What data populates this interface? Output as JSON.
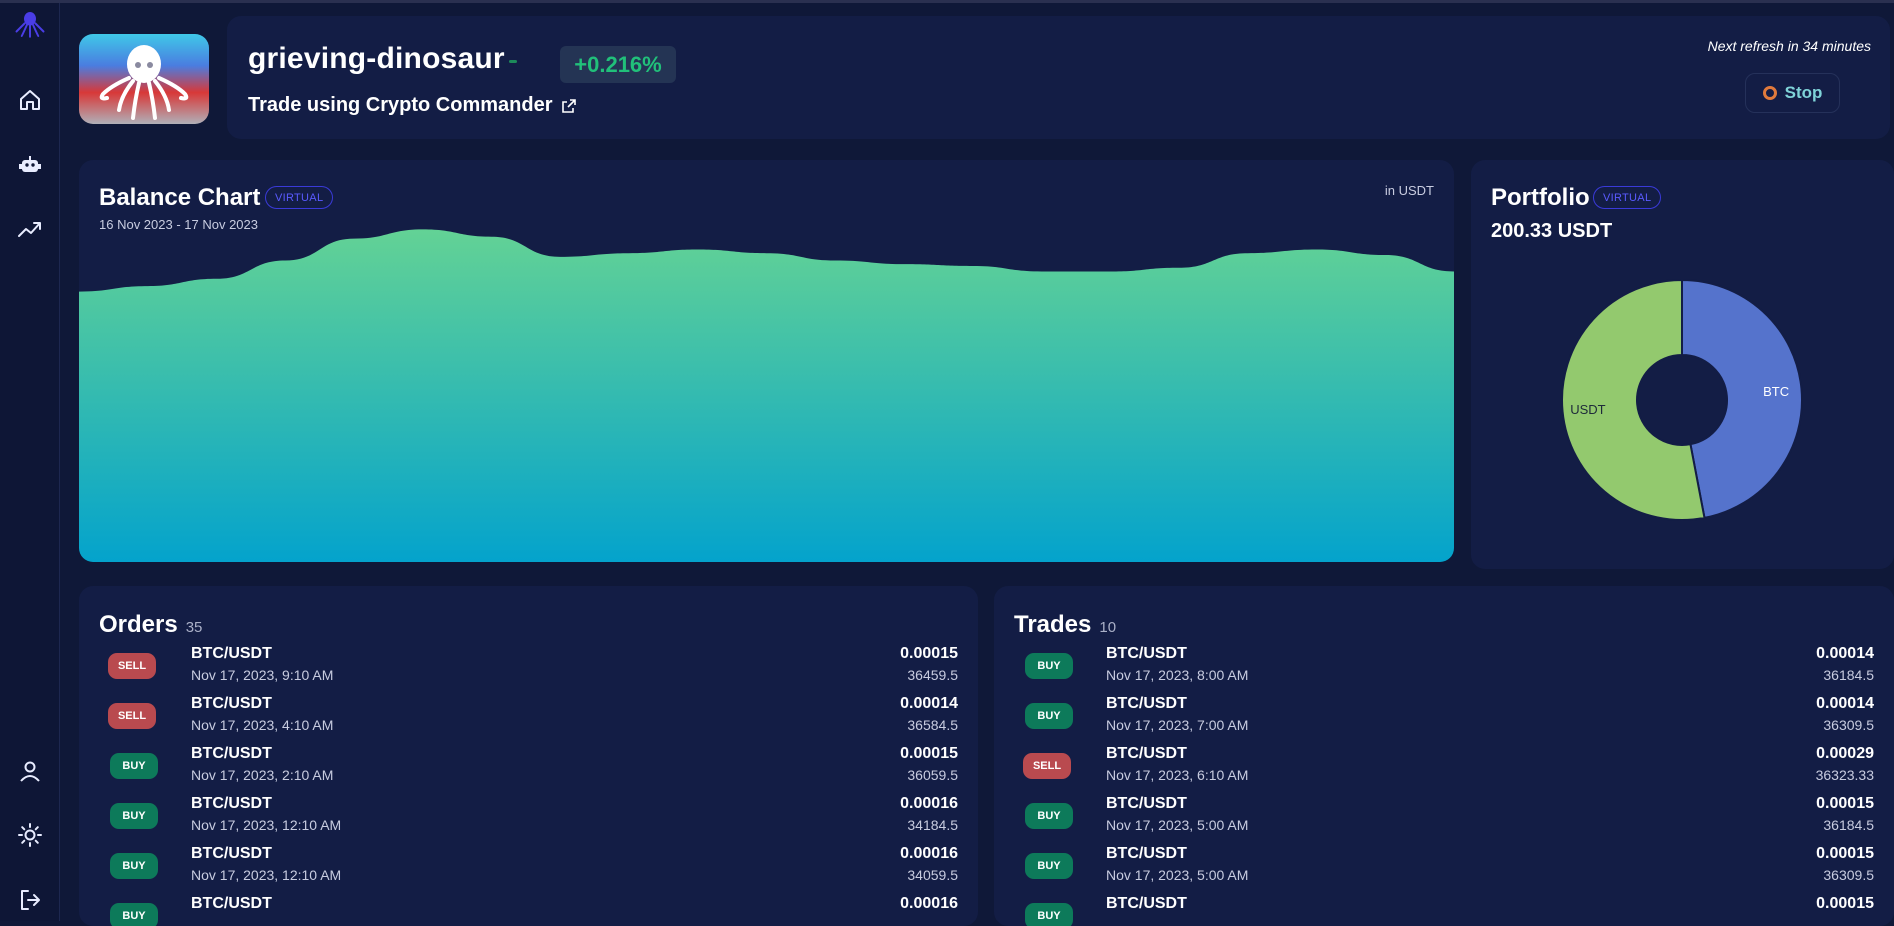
{
  "sidebar": {
    "items": [
      {
        "name": "home",
        "icon": "home-icon"
      },
      {
        "name": "bots",
        "icon": "robot-icon"
      },
      {
        "name": "markets",
        "icon": "trending-up-icon"
      },
      {
        "name": "account",
        "icon": "user-icon"
      },
      {
        "name": "theme",
        "icon": "sun-icon"
      },
      {
        "name": "logout",
        "icon": "logout-icon"
      }
    ]
  },
  "header": {
    "bot_name": "grieving-dinosaur",
    "change_pct": "+0.216%",
    "trade_link": "Trade using Crypto Commander",
    "refresh_text": "Next refresh in 34 minutes",
    "stop_label": "Stop"
  },
  "balance": {
    "title": "Balance Chart",
    "badge": "VIRTUAL",
    "date_range": "16 Nov 2023 - 17 Nov 2023",
    "unit": "in USDT"
  },
  "portfolio": {
    "title": "Portfolio",
    "badge": "VIRTUAL",
    "total": "200.33 USDT"
  },
  "chart_data": [
    {
      "type": "area",
      "title": "Balance Chart",
      "unit": "USDT",
      "x": [
        0,
        1,
        2,
        3,
        4,
        5,
        6,
        7,
        8,
        9,
        10,
        11,
        12,
        13,
        14,
        15,
        16,
        17,
        18,
        19,
        20
      ],
      "values": [
        199.4,
        199.55,
        199.75,
        200.25,
        200.85,
        201.1,
        200.9,
        200.35,
        200.45,
        200.55,
        200.45,
        200.25,
        200.15,
        200.1,
        199.95,
        199.95,
        200.05,
        200.45,
        200.55,
        200.4,
        199.95
      ],
      "ylim": [
        192,
        203
      ],
      "colors": {
        "top": "#63d295",
        "bottom": "#04a3cc"
      }
    },
    {
      "type": "pie",
      "title": "Portfolio",
      "categories": [
        "BTC",
        "USDT"
      ],
      "values": [
        47,
        53
      ],
      "colors": [
        "#5573cc",
        "#93c96e"
      ]
    }
  ],
  "orders": {
    "title": "Orders",
    "count": "35",
    "rows": [
      {
        "side": "SELL",
        "pair": "BTC/USDT",
        "time": "Nov 17, 2023, 9:10 AM",
        "amount": "0.00015",
        "price": "36459.5"
      },
      {
        "side": "SELL",
        "pair": "BTC/USDT",
        "time": "Nov 17, 2023, 4:10 AM",
        "amount": "0.00014",
        "price": "36584.5"
      },
      {
        "side": "BUY",
        "pair": "BTC/USDT",
        "time": "Nov 17, 2023, 2:10 AM",
        "amount": "0.00015",
        "price": "36059.5"
      },
      {
        "side": "BUY",
        "pair": "BTC/USDT",
        "time": "Nov 17, 2023, 12:10 AM",
        "amount": "0.00016",
        "price": "34184.5"
      },
      {
        "side": "BUY",
        "pair": "BTC/USDT",
        "time": "Nov 17, 2023, 12:10 AM",
        "amount": "0.00016",
        "price": "34059.5"
      },
      {
        "side": "BUY",
        "pair": "BTC/USDT",
        "time": "",
        "amount": "0.00016",
        "price": ""
      }
    ]
  },
  "trades": {
    "title": "Trades",
    "count": "10",
    "rows": [
      {
        "side": "BUY",
        "pair": "BTC/USDT",
        "time": "Nov 17, 2023, 8:00 AM",
        "amount": "0.00014",
        "price": "36184.5"
      },
      {
        "side": "BUY",
        "pair": "BTC/USDT",
        "time": "Nov 17, 2023, 7:00 AM",
        "amount": "0.00014",
        "price": "36309.5"
      },
      {
        "side": "SELL",
        "pair": "BTC/USDT",
        "time": "Nov 17, 2023, 6:10 AM",
        "amount": "0.00029",
        "price": "36323.33"
      },
      {
        "side": "BUY",
        "pair": "BTC/USDT",
        "time": "Nov 17, 2023, 5:00 AM",
        "amount": "0.00015",
        "price": "36184.5"
      },
      {
        "side": "BUY",
        "pair": "BTC/USDT",
        "time": "Nov 17, 2023, 5:00 AM",
        "amount": "0.00015",
        "price": "36309.5"
      },
      {
        "side": "BUY",
        "pair": "BTC/USDT",
        "time": "",
        "amount": "0.00015",
        "price": ""
      }
    ]
  }
}
